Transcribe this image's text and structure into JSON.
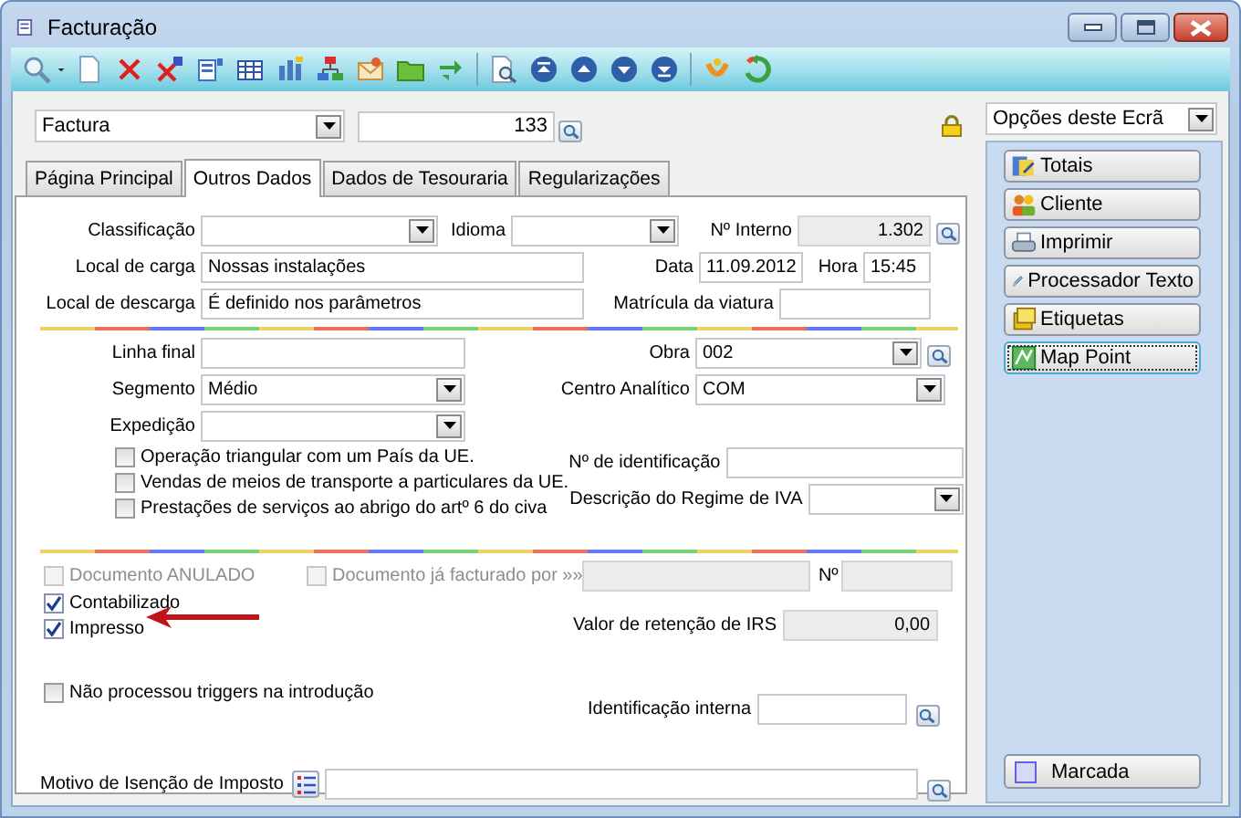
{
  "window": {
    "title": "Facturação"
  },
  "document": {
    "type": "Factura",
    "number": "133"
  },
  "screen_options": {
    "value": "Opções deste Ecrã"
  },
  "tabs": [
    {
      "label": "Página Principal",
      "selected": false
    },
    {
      "label": "Outros Dados",
      "selected": true
    },
    {
      "label": "Dados de Tesouraria",
      "selected": false
    },
    {
      "label": "Regularizações",
      "selected": false
    }
  ],
  "general": {
    "classificacao": {
      "label": "Classificação"
    },
    "idioma": {
      "label": "Idioma"
    },
    "numero_interno": {
      "label": "Nº Interno",
      "value": "1.302",
      "disabled": true
    },
    "local_carga": {
      "label": "Local de carga",
      "value": "Nossas instalações"
    },
    "data": {
      "label": "Data",
      "value": "11.09.2012"
    },
    "hora": {
      "label": "Hora",
      "value": "15:45"
    },
    "local_descarga": {
      "label": "Local de descarga",
      "value": "É definido nos parâmetros"
    },
    "matricula": {
      "label": "Matrícula da viatura"
    }
  },
  "details": {
    "linha_final": {
      "label": "Linha final"
    },
    "obra": {
      "label": "Obra",
      "value": "002"
    },
    "segmento": {
      "label": "Segmento",
      "value": "Médio"
    },
    "centro_analitico": {
      "label": "Centro Analítico",
      "value": "COM"
    },
    "expedicao": {
      "label": "Expedição"
    },
    "options": [
      {
        "label": "Operação triangular com um País da UE.",
        "checked": false,
        "disabled": false
      },
      {
        "label": "Vendas de meios de transporte a particulares da UE.",
        "checked": false,
        "disabled": false
      },
      {
        "label": "Prestações de serviços ao abrigo do artº 6 do civa",
        "checked": false,
        "disabled": false
      }
    ],
    "numero_identificacao": {
      "label": "Nº de identificação"
    },
    "regime_iva": {
      "label": "Descrição do Regime de IVA"
    }
  },
  "status": {
    "anulado": {
      "label": "Documento ANULADO",
      "checked": false,
      "disabled": true
    },
    "ja_facturado": {
      "label": "Documento já facturado por »»",
      "checked": false,
      "disabled": true
    },
    "ja_facturado_ref": {
      "disabled": true
    },
    "numero": {
      "label": "Nº",
      "disabled": true
    },
    "contabilizado": {
      "label": "Contabilizado",
      "checked": true,
      "disabled": false
    },
    "impresso": {
      "label": "Impresso",
      "checked": true,
      "disabled": false
    },
    "retencao_irs": {
      "label": "Valor de retenção de IRS",
      "value": "0,00",
      "disabled": true
    },
    "sem_triggers": {
      "label": "Não processou triggers na introdução",
      "checked": false,
      "disabled": false
    },
    "identificacao_interna": {
      "label": "Identificação interna"
    },
    "motivo_isencao": {
      "label": "Motivo de Isenção de Imposto"
    }
  },
  "side_buttons": [
    {
      "label": "Totais",
      "focused": false
    },
    {
      "label": "Cliente",
      "focused": false
    },
    {
      "label": "Imprimir",
      "focused": false
    },
    {
      "label": "Processador Texto",
      "focused": false
    },
    {
      "label": "Etiquetas",
      "focused": false
    },
    {
      "label": "Map Point",
      "focused": true
    }
  ],
  "marcada": {
    "label": "Marcada"
  }
}
